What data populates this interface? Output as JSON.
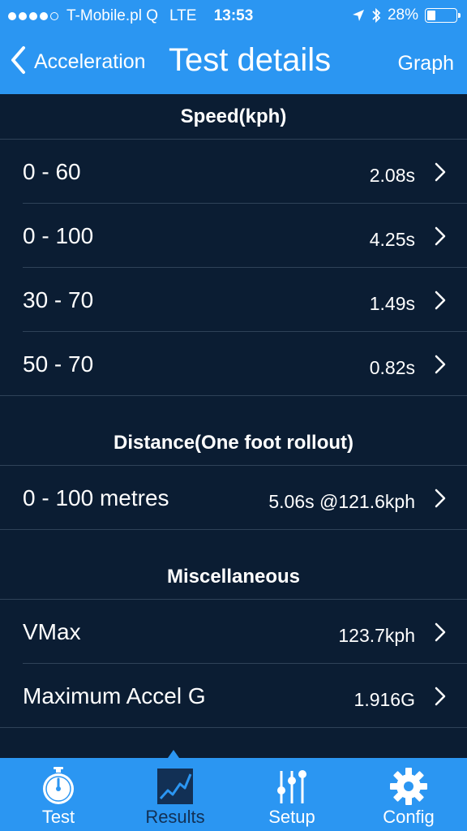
{
  "status_bar": {
    "carrier": "T-Mobile.pl Q",
    "network": "LTE",
    "time": "13:53",
    "battery": "28%",
    "battery_level": 0.28
  },
  "nav": {
    "back_label": "Acceleration",
    "title": "Test details",
    "right_button": "Graph"
  },
  "sections": {
    "speed": {
      "title": "Speed(kph)",
      "rows": [
        {
          "label": "0 - 60",
          "value": "2.08s"
        },
        {
          "label": "0 - 100",
          "value": "4.25s"
        },
        {
          "label": "30 - 70",
          "value": "1.49s"
        },
        {
          "label": "50 - 70",
          "value": "0.82s"
        }
      ]
    },
    "distance": {
      "title": "Distance(One foot rollout)",
      "rows": [
        {
          "label": "0 - 100 metres",
          "value": "5.06s @121.6kph"
        }
      ]
    },
    "misc": {
      "title": "Miscellaneous",
      "rows": [
        {
          "label": "VMax",
          "value": "123.7kph"
        },
        {
          "label": "Maximum Accel G",
          "value": "1.916G"
        }
      ]
    }
  },
  "tabs": [
    {
      "label": "Test",
      "icon": "stopwatch-icon"
    },
    {
      "label": "Results",
      "icon": "chart-icon",
      "active": true
    },
    {
      "label": "Setup",
      "icon": "sliders-icon"
    },
    {
      "label": "Config",
      "icon": "gear-icon"
    }
  ],
  "colors": {
    "accent": "#2b96f2",
    "background": "#0b1d33",
    "active_tab_text": "#123055"
  }
}
